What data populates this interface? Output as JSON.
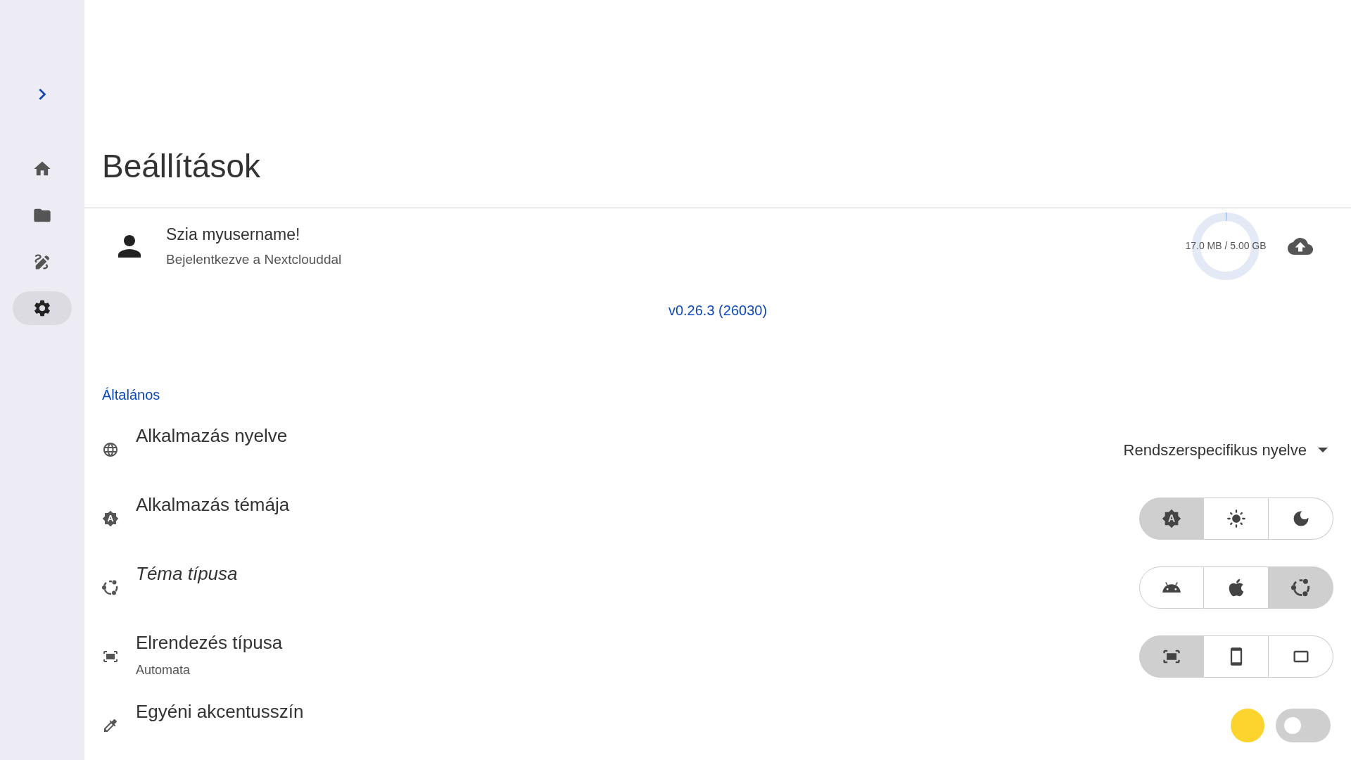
{
  "sidebar": {
    "items": [
      {
        "selected": false
      },
      {
        "selected": false
      },
      {
        "selected": false
      },
      {
        "selected": true
      }
    ]
  },
  "title": "Beállítások",
  "account": {
    "greeting": "Szia myusername!",
    "subtitle": "Bejelentkezve a Nextclouddal",
    "storage": {
      "reading": "17.0 MB / 5.00 GB",
      "level": 0.0034
    }
  },
  "version": "v0.26.3 (26030)",
  "section": "Általános",
  "settings": [
    {
      "kind": "dropdown",
      "label": "Alkalmazás nyelve",
      "value": "Rendszerspecifikus nyelve"
    },
    {
      "kind": "segmented",
      "label": "Alkalmazás témája",
      "options": [
        {
          "selected": true
        },
        {
          "selected": false
        },
        {
          "selected": false
        }
      ]
    },
    {
      "kind": "segmented",
      "label": "Téma típusa",
      "italic": true,
      "options": [
        {
          "selected": false
        },
        {
          "selected": false
        },
        {
          "selected": true
        }
      ]
    },
    {
      "kind": "segmented",
      "label": "Elrendezés típusa",
      "subtitle": "Automata",
      "options": [
        {
          "selected": true
        },
        {
          "selected": false
        },
        {
          "selected": false
        }
      ]
    },
    {
      "kind": "color_toggle",
      "label": "Egyéni akcentusszín",
      "color": "#fdd32e",
      "on": false
    }
  ]
}
